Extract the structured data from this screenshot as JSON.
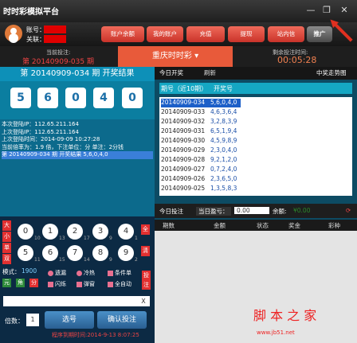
{
  "app": {
    "title": "时时彩模拟平台"
  },
  "window": {
    "minimize": "—",
    "restore": "❐",
    "close": "✕"
  },
  "user": {
    "account_label": "账号：",
    "balance_label": "关联："
  },
  "top_buttons": [
    "账户余额",
    "我的账户",
    "充值",
    "提现",
    "站内信"
  ],
  "promo_label": "推广",
  "info": {
    "current_period_label": "当前投注:",
    "current_period": "第  20140909-035 期",
    "lottery": "重庆时时彩",
    "remain_label": "剩余投注时间:",
    "remain_time": "00:05:28"
  },
  "draw": {
    "header": "第  20140909-034  期  开奖结果",
    "balls": [
      "5",
      "6",
      "0",
      "4",
      "0"
    ]
  },
  "log": [
    "本次登陆IP：112.65.211.164",
    "上次登陆IP：112.65.211.164",
    "上次登陆时间：2014-09-09 10:27:28",
    "当前倍率为：1.9 倍，下注单位：分 单注：2分钱",
    "第 20140909-034 期 开奖结果  5,6,0,4,0"
  ],
  "bet": {
    "side_top": [
      "大",
      "小",
      "单",
      "双"
    ],
    "side_right": [
      "全",
      "清"
    ],
    "numbers_row1": [
      {
        "n": "0",
        "tag": "10"
      },
      {
        "n": "1",
        "tag": "13"
      },
      {
        "n": "2",
        "tag": "17"
      },
      {
        "n": "3",
        "tag": "9"
      },
      {
        "n": "4",
        "tag": "1"
      }
    ],
    "numbers_row2": [
      {
        "n": "5",
        "tag": "11"
      },
      {
        "n": "6",
        "tag": "15"
      },
      {
        "n": "7",
        "tag": "14"
      },
      {
        "n": "8",
        "tag": "9"
      },
      {
        "n": "9",
        "tag": "2"
      }
    ],
    "mode_label": "模式：",
    "mode_value": "1900",
    "units": [
      "元",
      "角",
      "分"
    ],
    "options_row1": [
      "遗漏",
      "冷热",
      "条件单"
    ],
    "options_row2": [
      "闪烁",
      "弹窗",
      "全自动"
    ],
    "confirm_side": "投注",
    "input_clear": "X",
    "multiplier_label": "倍数：",
    "multiplier_value": "1",
    "select_button": "选号",
    "confirm_button": "确认投注",
    "expire": "程序到期时间:2014-9-13 8:07:25"
  },
  "right": {
    "tabs": [
      "今日开奖",
      "刷新"
    ],
    "trend": "中奖走势图",
    "list_header": "期号（近10期）",
    "list_header2": "开奖号",
    "rows": [
      {
        "period": "20140909-034",
        "nums": "5,6,0,4,0"
      },
      {
        "period": "20140909-033",
        "nums": "4,6,3,6,4"
      },
      {
        "period": "20140909-032",
        "nums": "3,2,8,3,9"
      },
      {
        "period": "20140909-031",
        "nums": "6,5,1,9,4"
      },
      {
        "period": "20140909-030",
        "nums": "4,5,9,8,9"
      },
      {
        "period": "20140909-029",
        "nums": "2,3,0,4,0"
      },
      {
        "period": "20140909-028",
        "nums": "9,2,1,2,0"
      },
      {
        "period": "20140909-027",
        "nums": "0,7,2,4,0"
      },
      {
        "period": "20140909-026",
        "nums": "2,3,6,5,0"
      },
      {
        "period": "20140909-025",
        "nums": "1,3,5,8,3"
      }
    ],
    "today_bet": "今日投注",
    "today_surplus_label": "当日盈亏：",
    "today_surplus": "0.00",
    "balance_label": "余额:",
    "balance_value": "¥0.00",
    "columns": [
      "期数",
      "金额",
      "状态",
      "奖金",
      "彩种"
    ]
  },
  "watermark": {
    "text": "脚 本 之 家",
    "url": "www.jb51.net"
  }
}
